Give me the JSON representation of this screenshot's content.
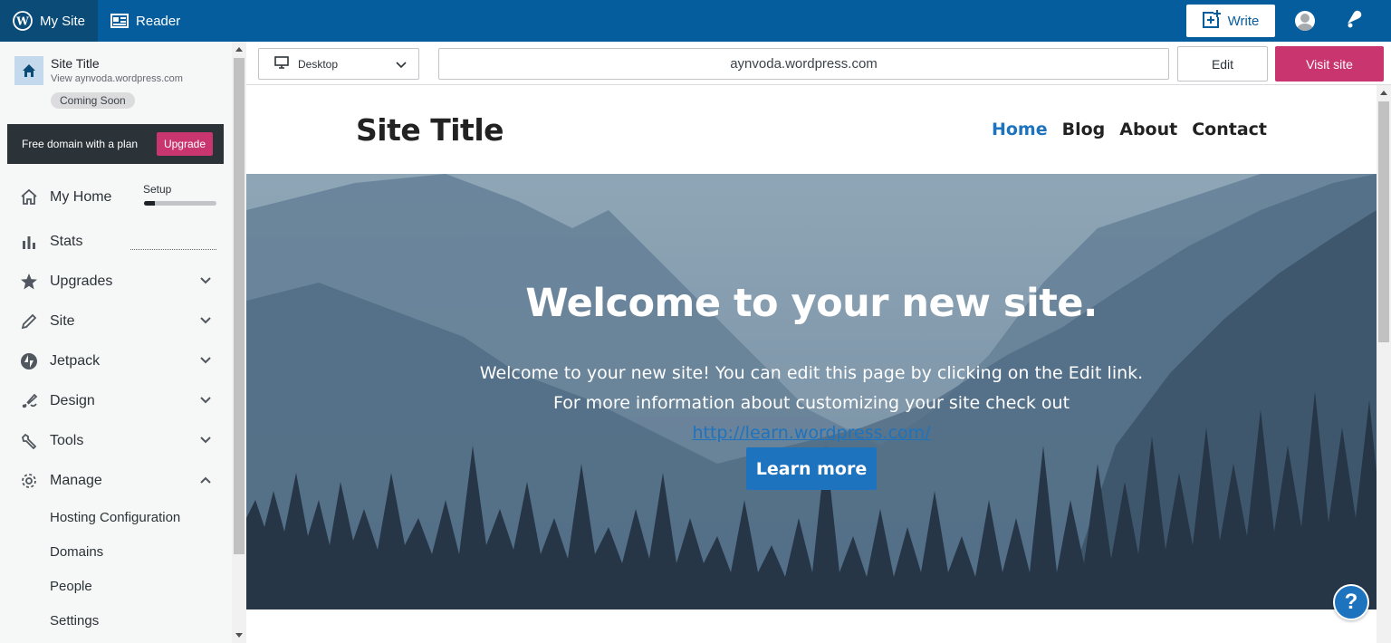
{
  "masterbar": {
    "my_site": "My Site",
    "reader": "Reader",
    "write": "Write"
  },
  "sidebar": {
    "site_title": "Site Title",
    "site_url": "View aynvoda.wordpress.com",
    "badge": "Coming Soon",
    "promo_text": "Free domain with a plan",
    "promo_button": "Upgrade",
    "setup_label": "Setup",
    "setup_progress": 0.15,
    "items": [
      {
        "label": "My Home"
      },
      {
        "label": "Stats"
      },
      {
        "label": "Upgrades"
      },
      {
        "label": "Site"
      },
      {
        "label": "Jetpack"
      },
      {
        "label": "Design"
      },
      {
        "label": "Tools"
      },
      {
        "label": "Manage"
      }
    ],
    "manage_sub": [
      "Hosting Configuration",
      "Domains",
      "People",
      "Settings"
    ]
  },
  "preview_bar": {
    "device": "Desktop",
    "url": "aynvoda.wordpress.com",
    "edit": "Edit",
    "visit": "Visit site"
  },
  "preview": {
    "site_title": "Site Title",
    "nav": [
      "Home",
      "Blog",
      "About",
      "Contact"
    ],
    "hero_title": "Welcome to your new site.",
    "hero_text": "Welcome to your new site! You can edit this page by clicking on the Edit link. For more information about customizing your site check out ",
    "hero_link": "http://learn.wordpress.com/",
    "hero_button": "Learn more"
  },
  "help": "?",
  "colors": {
    "masterbar": "#065d9e",
    "accent_pink": "#c9356e",
    "link_blue": "#1e73be"
  }
}
